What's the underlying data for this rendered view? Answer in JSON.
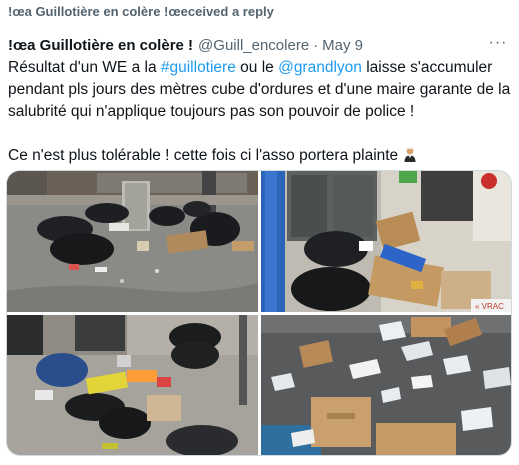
{
  "reply_context": {
    "text": "!œa Guillotière en colère !œeceived a reply"
  },
  "tweet": {
    "display_name": "!œa Guillotière en colère !",
    "username": "@Guill_encolere",
    "separator": "·",
    "date": "May 9",
    "more_label": "···",
    "text_1": "Résultat d'un WE a la ",
    "hashtag": "#guillotiere",
    "text_2": " ou le ",
    "mention": "@grandlyon",
    "text_3": "  laisse s'accumuler pendant pls jours des mètres cube d'ordures et d'une maire garante de la salubrité qui n'applique toujours pas son pouvoir de police !",
    "text_4": "Ce n'est plus tolérable ! cette fois ci l'asso portera plainte",
    "emoji_icon": "judge-emoji"
  },
  "media": {
    "photos": [
      {
        "name": "photo-street-trash-bags",
        "text": ""
      },
      {
        "name": "photo-bins-cardboard",
        "text": "« VRAC"
      },
      {
        "name": "photo-sidewalk-bags",
        "text": ""
      },
      {
        "name": "photo-cardboard-papers",
        "text": ""
      }
    ]
  },
  "colors": {
    "link": "#1d9bf0",
    "muted": "#536471",
    "text": "#0f1419",
    "border": "#cfd9de"
  }
}
